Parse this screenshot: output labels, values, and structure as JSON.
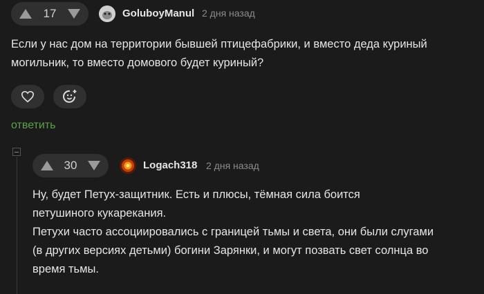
{
  "comment1": {
    "votes": "17",
    "username": "GoluboyManul",
    "time": "2 дня назад",
    "text": "Если у нас дом на территории бывшей птицефабрики, и вместо деда куриный\nмогильник, то вместо домового будет куриный?",
    "reply_label": "ответить"
  },
  "comment2": {
    "votes": "30",
    "username": "Logach318",
    "time": "2 дня назад",
    "text": "Ну, будет Петух-защитник. Есть и плюсы, тёмная сила боится\nпетушиного кукарекания.\nПетухи часто ассоциировались с границей тьмы и света, они были слугами\n(в других версиях детьми) богини Зарянки, и могут позвать свет солнца во\nвремя тьмы."
  },
  "colors": {
    "background": "#1b1b1b",
    "reply_green": "#5aa34a"
  }
}
